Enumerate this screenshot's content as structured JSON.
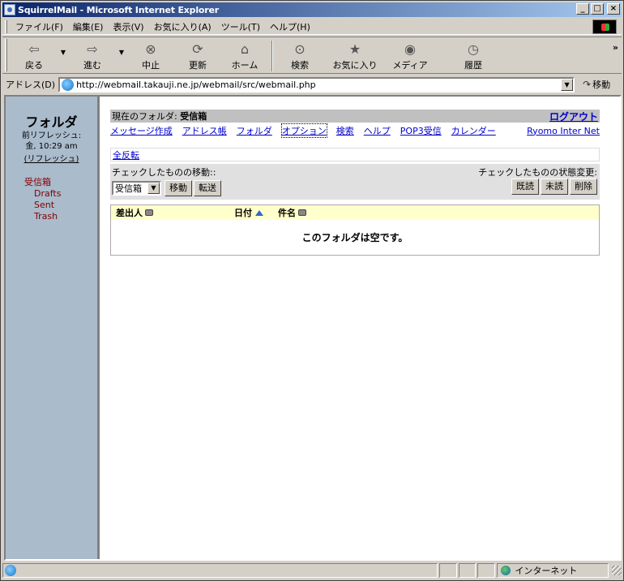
{
  "window": {
    "title": "SquirrelMail - Microsoft Internet Explorer"
  },
  "menubar": {
    "items": [
      "ファイル(F)",
      "編集(E)",
      "表示(V)",
      "お気に入り(A)",
      "ツール(T)",
      "ヘルプ(H)"
    ]
  },
  "toolbar": {
    "back": "戻る",
    "forward": "進む",
    "stop": "中止",
    "refresh": "更新",
    "home": "ホーム",
    "search": "検索",
    "favorites": "お気に入り",
    "media": "メディア",
    "history": "履歴",
    "more": "»"
  },
  "address": {
    "label": "アドレス(D)",
    "url": "http://webmail.takauji.ne.jp/webmail/src/webmail.php",
    "go": "移動"
  },
  "sidebar": {
    "title": "フォルダ",
    "refresh_label": "前リフレッシュ:",
    "refresh_time": "金, 10:29 am",
    "refresh_link": "(リフレッシュ)",
    "folders": [
      "受信箱",
      "Drafts",
      "Sent",
      "Trash"
    ]
  },
  "main": {
    "current_folder_label": "現在のフォルダ:",
    "current_folder": "受信箱",
    "logout": "ログアウト",
    "nav": [
      "メッセージ作成",
      "アドレス帳",
      "フォルダ",
      "オプション",
      "検索",
      "ヘルプ",
      "POP3受信",
      "カレンダー"
    ],
    "nav_right": "Ryomo Inter Net",
    "toggle_all": "全反転",
    "move_label": "チェックしたものの移動::",
    "status_label": "チェックしたものの状態変更:",
    "move_target": "受信箱",
    "move_button": "移動",
    "forward_button": "転送",
    "read_button": "既読",
    "unread_button": "未読",
    "delete_button": "削除",
    "columns": {
      "from": "差出人",
      "date": "日付",
      "subject": "件名"
    },
    "empty_message": "このフォルダは空です。"
  },
  "statusbar": {
    "zone": "インターネット"
  }
}
